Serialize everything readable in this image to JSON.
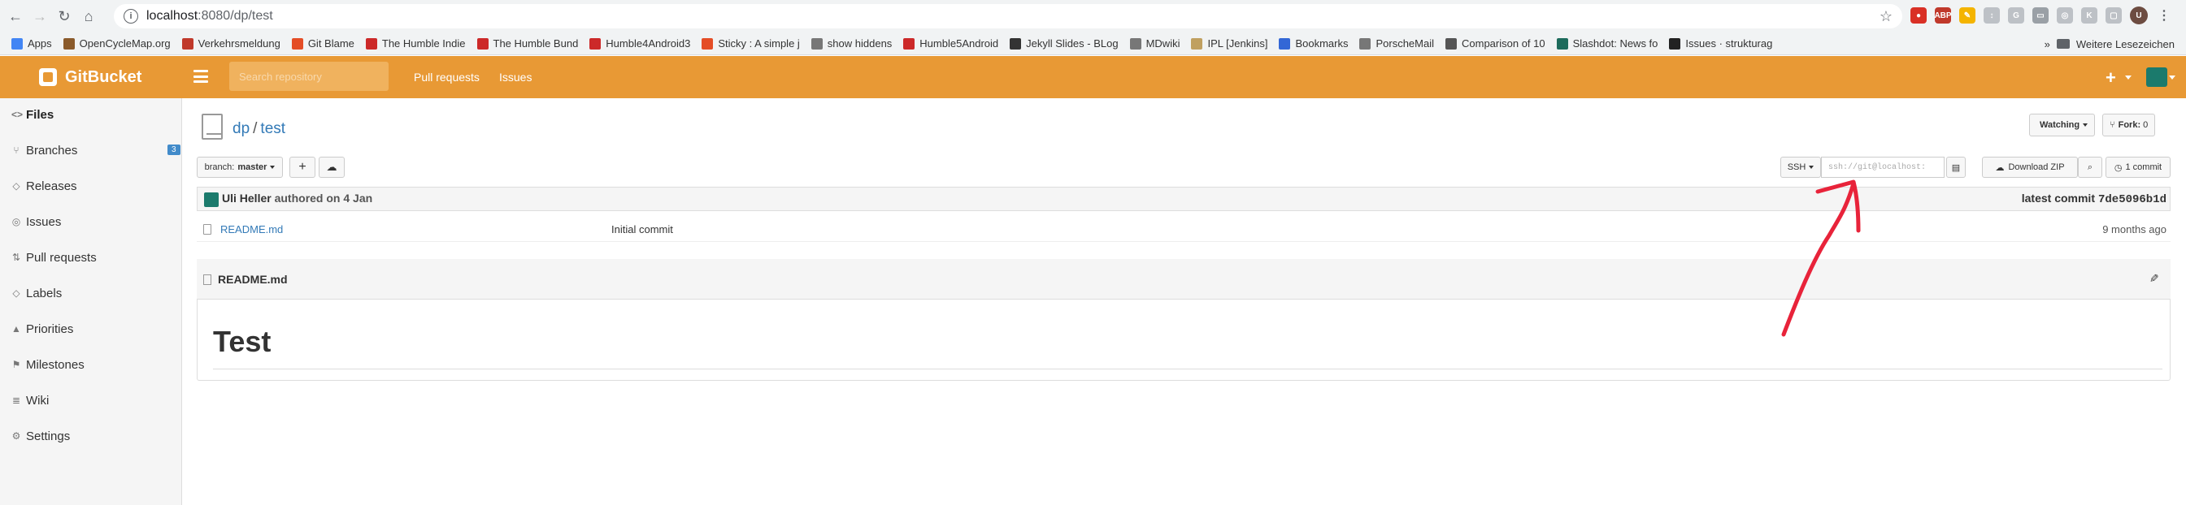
{
  "browser": {
    "url_host": "localhost",
    "url_path": ":8080/dp/test",
    "bookmarks": [
      {
        "label": "Apps",
        "color": "#4285f4"
      },
      {
        "label": "OpenCycleMap.org",
        "color": "#8a5a2b"
      },
      {
        "label": "Verkehrsmeldung",
        "color": "#c0392b"
      },
      {
        "label": "Git Blame",
        "color": "#e44d26"
      },
      {
        "label": "The Humble Indie",
        "color": "#cc2929"
      },
      {
        "label": "The Humble Bund",
        "color": "#cc2929"
      },
      {
        "label": "Humble4Android3",
        "color": "#cc2929"
      },
      {
        "label": "Sticky : A simple j",
        "color": "#e44d26"
      },
      {
        "label": "show hiddens",
        "color": "#777777"
      },
      {
        "label": "Humble5Android",
        "color": "#cc2929"
      },
      {
        "label": "Jekyll Slides - BLog",
        "color": "#333333"
      },
      {
        "label": "MDwiki",
        "color": "#777777"
      },
      {
        "label": "IPL [Jenkins]",
        "color": "#c0a060"
      },
      {
        "label": "Bookmarks",
        "color": "#3367d6"
      },
      {
        "label": "PorscheMail",
        "color": "#777777"
      },
      {
        "label": "Comparison of 10",
        "color": "#555555"
      },
      {
        "label": "Slashdot: News fo",
        "color": "#1d6b5c"
      },
      {
        "label": "Issues · strukturag",
        "color": "#222222"
      }
    ],
    "more": "»",
    "other_bookmarks": "Weitere Lesezeichen",
    "profile_initial": "U"
  },
  "header": {
    "brand": "GitBucket",
    "search_placeholder": "Search repository",
    "links": [
      "Pull requests",
      "Issues"
    ],
    "plus": "+"
  },
  "sidebar": {
    "items": [
      {
        "label": "Files",
        "icon": "code-icon",
        "glyph": "<>"
      },
      {
        "label": "Branches",
        "icon": "branch-icon",
        "glyph": "⑂",
        "badge": "3"
      },
      {
        "label": "Releases",
        "icon": "tag-icon",
        "glyph": "◇"
      },
      {
        "label": "Issues",
        "icon": "issue-icon",
        "glyph": "◎"
      },
      {
        "label": "Pull requests",
        "icon": "pull-request-icon",
        "glyph": "⇅"
      },
      {
        "label": "Labels",
        "icon": "label-icon",
        "glyph": "◇"
      },
      {
        "label": "Priorities",
        "icon": "flame-icon",
        "glyph": "▲"
      },
      {
        "label": "Milestones",
        "icon": "milestone-icon",
        "glyph": "⚑"
      },
      {
        "label": "Wiki",
        "icon": "book-icon",
        "glyph": "≣"
      },
      {
        "label": "Settings",
        "icon": "gear-icon",
        "glyph": "⚙"
      }
    ]
  },
  "repo": {
    "owner": "dp",
    "separator": "/",
    "name": "test",
    "watching": "Watching",
    "fork_label": "Fork:",
    "fork_count": "0",
    "branch_label": "branch:",
    "branch": "master",
    "protocol": "SSH",
    "clone_url": "ssh://git@localhost:",
    "download_zip": "Download ZIP",
    "commits": "1 commit"
  },
  "commit": {
    "author": "Uli Heller",
    "authored": "authored on 4 Jan",
    "latest_label": "latest commit",
    "sha": "7de5096b1d"
  },
  "files": [
    {
      "name": "README.md",
      "message": "Initial commit",
      "age": "9 months ago"
    }
  ],
  "readme": {
    "filename": "README.md",
    "heading": "Test"
  },
  "annotation": {
    "color": "#e8233a"
  }
}
